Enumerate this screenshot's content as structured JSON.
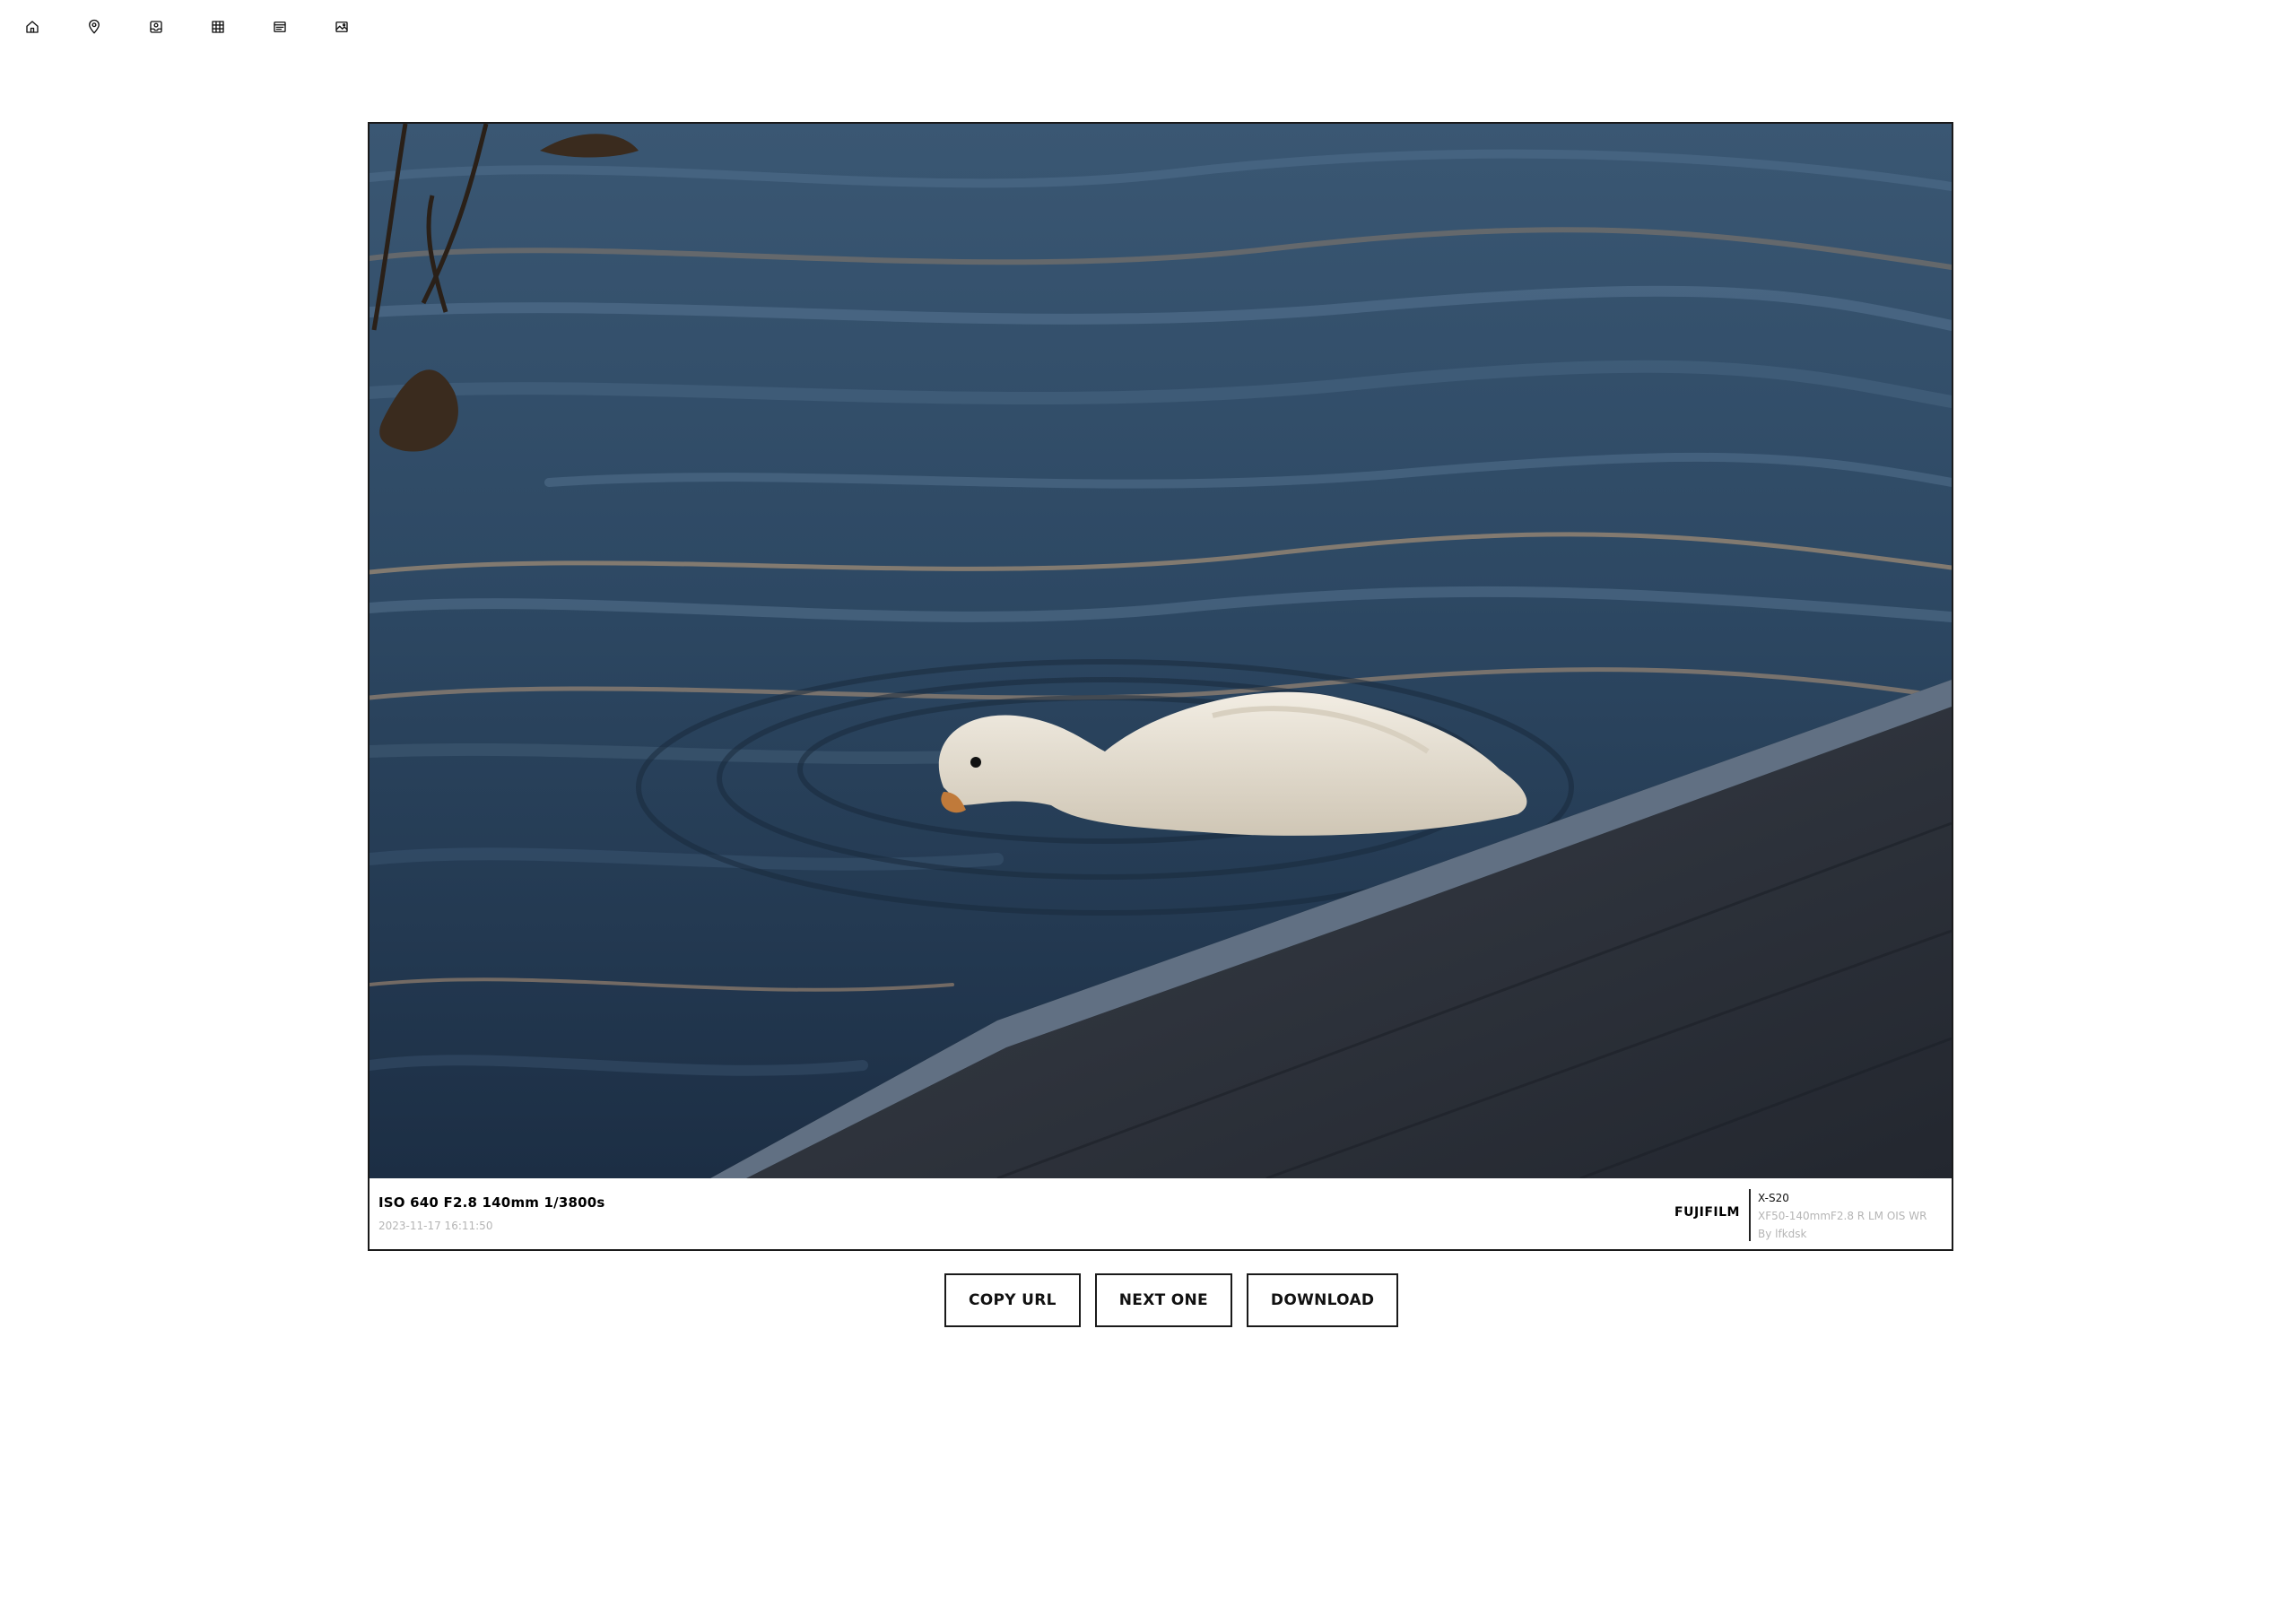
{
  "nav": {
    "icons": [
      "home-icon",
      "map-pin-icon",
      "inbox-icon",
      "grid-icon",
      "list-icon",
      "image-icon"
    ]
  },
  "photo": {
    "exif": "ISO 640 F2.8 140mm 1/3800s",
    "date": "2023-11-17 16:11:50",
    "brand": "FUJIFILM",
    "model": "X-S20",
    "lens": "XF50-140mmF2.8 R LM OIS WR",
    "author": "By lfkdsk"
  },
  "actions": {
    "copy_url": "COPY URL",
    "next_one": "NEXT ONE",
    "download": "DOWNLOAD"
  },
  "colors": {
    "water_dark": "#1f3247",
    "water_mid": "#3d5a78",
    "water_light": "#6f8aa5",
    "highlight_warm": "#c9a27a",
    "pavement": "#2e3440",
    "duck": "#ece6da"
  }
}
